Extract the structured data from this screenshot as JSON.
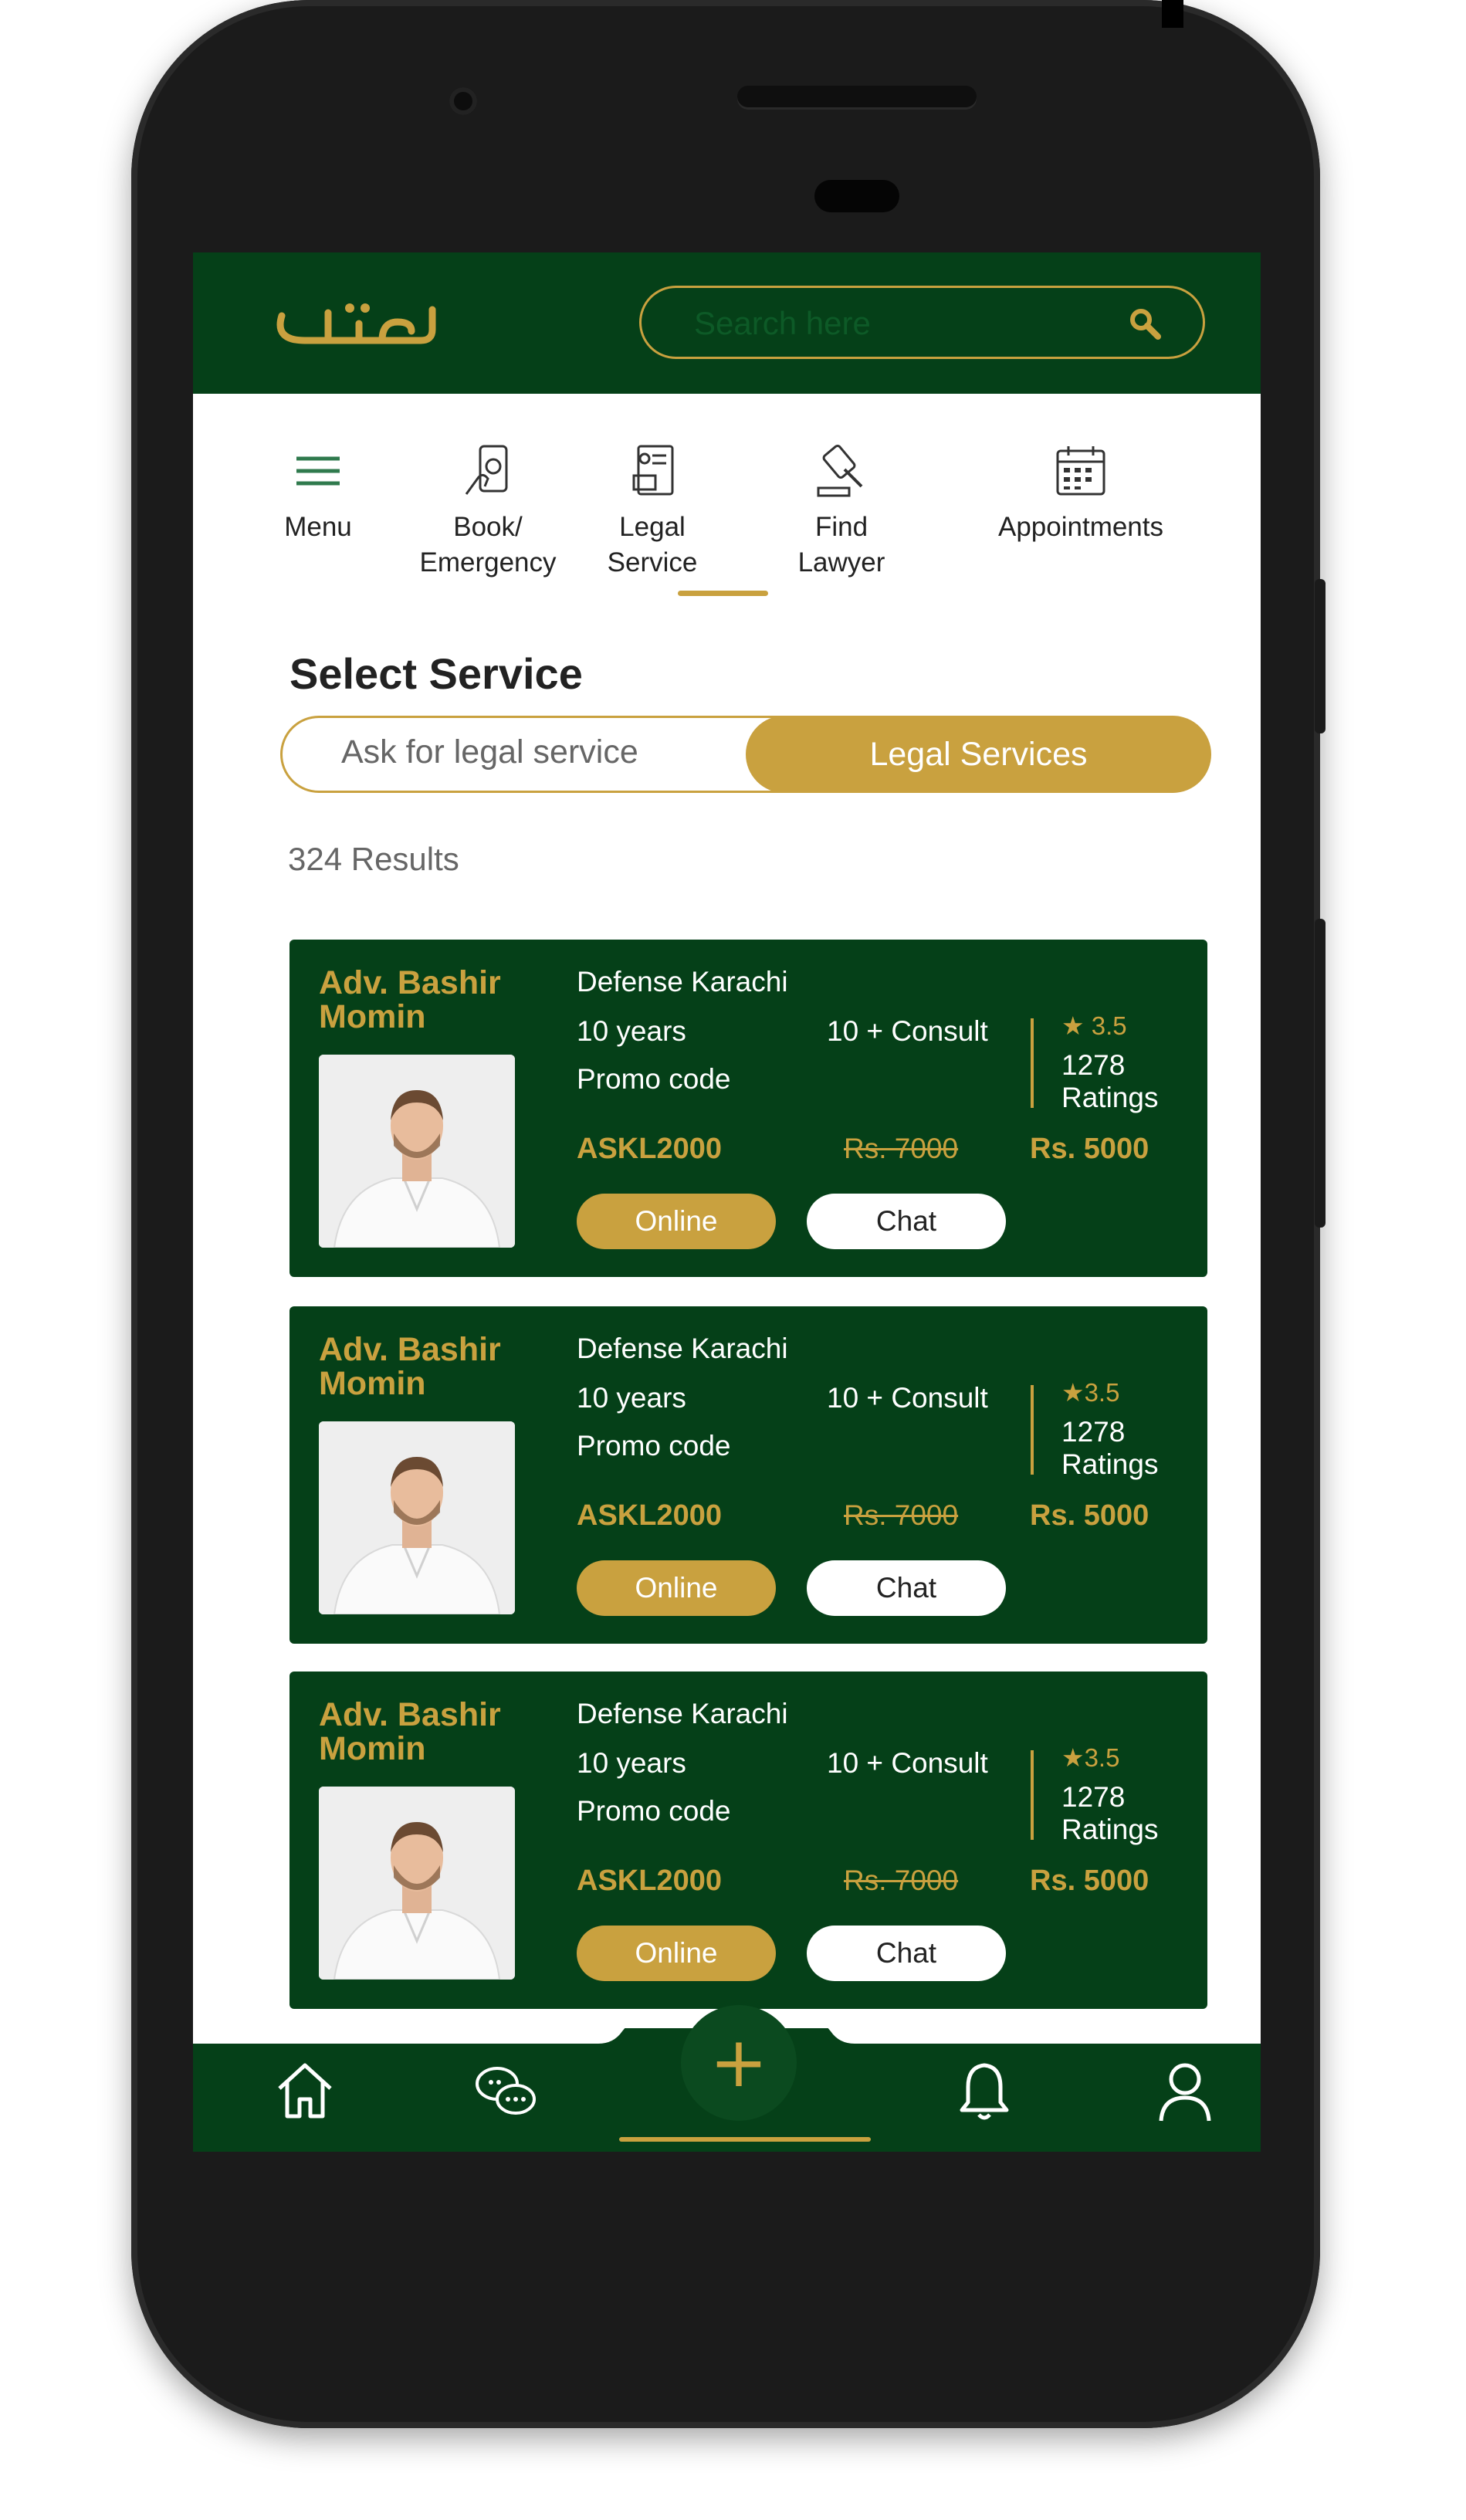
{
  "header": {
    "logo_text": "دلیل",
    "search_placeholder": "Search here"
  },
  "tabs": [
    {
      "line1": "Menu",
      "line2": ""
    },
    {
      "line1": "Book/",
      "line2": "Emergency"
    },
    {
      "line1": "Legal",
      "line2": "Service"
    },
    {
      "line1": "Find",
      "line2": "Lawyer"
    },
    {
      "line1": "Appointments",
      "line2": ""
    }
  ],
  "page": {
    "title": "Select Service",
    "toggle_left": "Ask for legal service",
    "toggle_right": "Legal Services",
    "results": "324 Results"
  },
  "cards": [
    {
      "name": "Adv. Bashir Momin",
      "location": "Defense Karachi",
      "experience": "10 years",
      "consults": "10 + Consult",
      "promo_label": "Promo code",
      "rating": "★ 3.5",
      "ratings_count": "1278",
      "ratings_label": "Ratings",
      "promo_code": "ASKL2000",
      "old_price": "Rs. 7000",
      "new_price": "Rs. 5000",
      "online": "Online",
      "chat": "Chat"
    },
    {
      "name": "Adv. Bashir Momin",
      "location": "Defense Karachi",
      "experience": "10 years",
      "consults": "10 + Consult",
      "promo_label": "Promo code",
      "rating": "★3.5",
      "ratings_count": "1278",
      "ratings_label": "Ratings",
      "promo_code": "ASKL2000",
      "old_price": "Rs. 7000",
      "new_price": "Rs. 5000",
      "online": "Online",
      "chat": "Chat"
    },
    {
      "name": "Adv. Bashir Momin",
      "location": "Defense Karachi",
      "experience": "10 years",
      "consults": "10 + Consult",
      "promo_label": "Promo code",
      "rating": "★3.5",
      "ratings_count": "1278",
      "ratings_label": "Ratings",
      "promo_code": "ASKL2000",
      "old_price": "Rs. 7000",
      "new_price": "Rs. 5000",
      "online": "Online",
      "chat": "Chat"
    }
  ],
  "bottom_nav": {
    "fab_symbol": "+",
    "items": [
      "home-icon",
      "chat-icon",
      "bell-icon",
      "profile-icon"
    ]
  },
  "colors": {
    "brand_green": "#054018",
    "accent_gold": "#c9a13f"
  }
}
